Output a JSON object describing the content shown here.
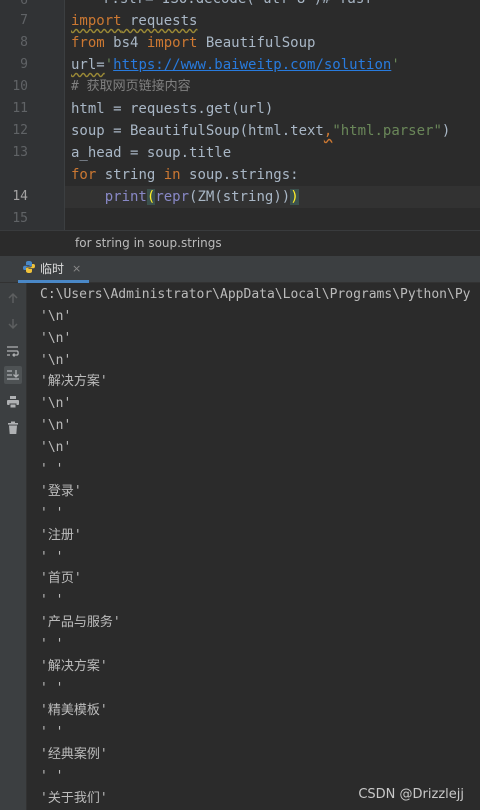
{
  "editor": {
    "line_numbers": [
      "6",
      "7",
      "8",
      "9",
      "10",
      "11",
      "12",
      "13",
      "14",
      "15"
    ],
    "clipped_top": "r.str= ISO.decode(\"utf-8\")# fasf",
    "lines": {
      "l7_kw": "import",
      "l7_rest": " requests",
      "l8_kw1": "from",
      "l8_mid": " bs4 ",
      "l8_kw2": "import",
      "l8_rest": " BeautifulSoup",
      "l9_a": "url=",
      "l9_q1": "'",
      "l9_url": "https://www.baiweitp.com/solution",
      "l9_q2": "'",
      "l10": "# 获取网页链接内容",
      "l11": "html = requests.get(url)",
      "l12_a": "soup = BeautifulSoup(html.text",
      "l12_comma": ",",
      "l12_str": "\"html.parser\"",
      "l12_close": ")",
      "l13": "a_head = soup.title",
      "l14_kw1": "for",
      "l14_a": " string ",
      "l14_kw2": "in",
      "l14_b": " soup.strings:",
      "l15_indent": "    ",
      "l15_print": "print",
      "l15_p1": "(",
      "l15_repr": "repr",
      "l15_mid": "(ZM(string))",
      "l15_p2": ")"
    },
    "breadcrumb": "for string in soup.strings"
  },
  "tool_window": {
    "tab_label": "临时",
    "tab_close": "×",
    "tools": [
      "up-arrow-icon",
      "down-arrow-icon",
      "soft-wrap-icon",
      "scroll-to-end-icon",
      "print-icon",
      "trash-icon"
    ]
  },
  "console": {
    "lines": [
      "C:\\Users\\Administrator\\AppData\\Local\\Programs\\Python\\Py",
      "'\\n'",
      "'\\n'",
      "'\\n'",
      "'解决方案'",
      "'\\n'",
      "'\\n'",
      "'\\n'",
      "' '",
      "'登录'",
      "' '",
      "'注册'",
      "' '",
      "'首页'",
      "' '",
      "'产品与服务'",
      "' '",
      "'解决方案'",
      "' '",
      "'精美模板'",
      "' '",
      "'经典案例'",
      "' '",
      "'关于我们'"
    ]
  },
  "watermark": "CSDN @Drizzlejj",
  "colors": {
    "background": "#2b2b2b",
    "keyword": "#cc7832",
    "string": "#6a8759",
    "link": "#287bde",
    "accent": "#4a88c7"
  }
}
